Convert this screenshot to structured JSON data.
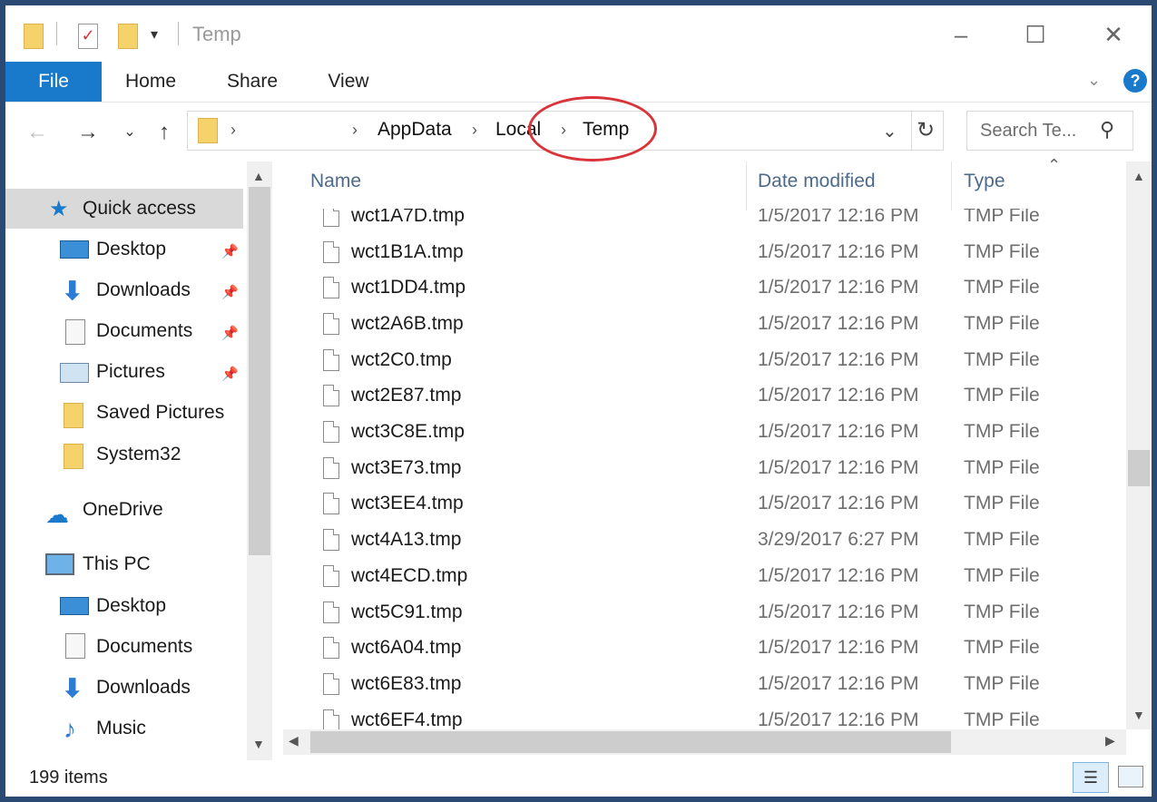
{
  "window": {
    "title": "Temp"
  },
  "ribbon": {
    "tabs": [
      "File",
      "Home",
      "Share",
      "View"
    ]
  },
  "address": {
    "crumbs": [
      "AppData",
      "Local",
      "Temp"
    ],
    "search_placeholder": "Search Te..."
  },
  "nav": {
    "quick_access": "Quick access",
    "quick_items": [
      "Desktop",
      "Downloads",
      "Documents",
      "Pictures",
      "Saved Pictures",
      "System32"
    ],
    "onedrive": "OneDrive",
    "this_pc": "This PC",
    "pc_items": [
      "Desktop",
      "Documents",
      "Downloads",
      "Music"
    ]
  },
  "columns": {
    "name": "Name",
    "date": "Date modified",
    "type": "Type"
  },
  "files": [
    {
      "name": "wct1A7D.tmp",
      "date": "1/5/2017 12:16 PM",
      "type": "TMP File"
    },
    {
      "name": "wct1B1A.tmp",
      "date": "1/5/2017 12:16 PM",
      "type": "TMP File"
    },
    {
      "name": "wct1DD4.tmp",
      "date": "1/5/2017 12:16 PM",
      "type": "TMP File"
    },
    {
      "name": "wct2A6B.tmp",
      "date": "1/5/2017 12:16 PM",
      "type": "TMP File"
    },
    {
      "name": "wct2C0.tmp",
      "date": "1/5/2017 12:16 PM",
      "type": "TMP File"
    },
    {
      "name": "wct2E87.tmp",
      "date": "1/5/2017 12:16 PM",
      "type": "TMP File"
    },
    {
      "name": "wct3C8E.tmp",
      "date": "1/5/2017 12:16 PM",
      "type": "TMP File"
    },
    {
      "name": "wct3E73.tmp",
      "date": "1/5/2017 12:16 PM",
      "type": "TMP File"
    },
    {
      "name": "wct3EE4.tmp",
      "date": "1/5/2017 12:16 PM",
      "type": "TMP File"
    },
    {
      "name": "wct4A13.tmp",
      "date": "3/29/2017 6:27 PM",
      "type": "TMP File"
    },
    {
      "name": "wct4ECD.tmp",
      "date": "1/5/2017 12:16 PM",
      "type": "TMP File"
    },
    {
      "name": "wct5C91.tmp",
      "date": "1/5/2017 12:16 PM",
      "type": "TMP File"
    },
    {
      "name": "wct6A04.tmp",
      "date": "1/5/2017 12:16 PM",
      "type": "TMP File"
    },
    {
      "name": "wct6E83.tmp",
      "date": "1/5/2017 12:16 PM",
      "type": "TMP File"
    },
    {
      "name": "wct6EF4.tmp",
      "date": "1/5/2017 12:16 PM",
      "type": "TMP File"
    }
  ],
  "status": {
    "count": "199 items"
  },
  "colors": {
    "accent": "#1979ca",
    "highlight_circle": "#d9343a"
  }
}
